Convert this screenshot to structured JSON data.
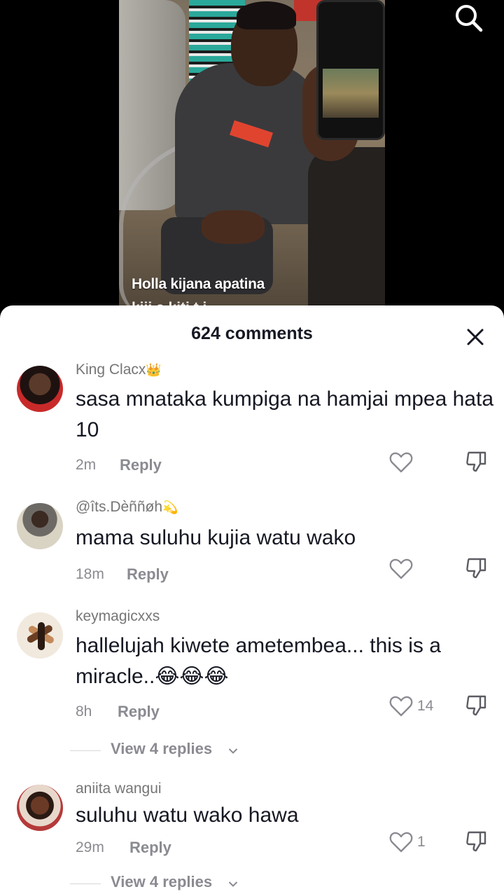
{
  "video": {
    "caption_line1": "Holla kijana apatina",
    "caption_line2": "kiji        a   kiti   t  i"
  },
  "icons": {
    "search": "search-icon",
    "close": "close-icon",
    "like": "heart-outline-icon",
    "dislike": "thumbs-down-icon",
    "chevron": "chevron-down-icon"
  },
  "colors": {
    "text_primary": "#161823",
    "text_secondary": "#8a8b91",
    "sheet_bg": "#ffffff"
  },
  "sheet": {
    "comment_count": "624 comments"
  },
  "comments": [
    {
      "username": "King Clacx",
      "username_emoji": "👑",
      "text": "sasa mnataka kumpiga na hamjai mpea hata 10",
      "time": "2m",
      "reply_label": "Reply",
      "likes": ""
    },
    {
      "username": "@îts.Dèññøh",
      "username_emoji": "💫",
      "text": "mama suluhu kujia watu wako",
      "time": "18m",
      "reply_label": "Reply",
      "likes": ""
    },
    {
      "username": "keymagicxxs",
      "username_emoji": "",
      "text": "hallelujah kiwete ametembea... this is a miracle..😂😂😂",
      "time": "8h",
      "reply_label": "Reply",
      "likes": "14",
      "view_replies": "View 4 replies"
    },
    {
      "username": "aniita wangui",
      "username_emoji": "",
      "text": "suluhu watu wako hawa",
      "time": "29m",
      "reply_label": "Reply",
      "likes": "1",
      "view_replies": "View 4 replies"
    }
  ]
}
